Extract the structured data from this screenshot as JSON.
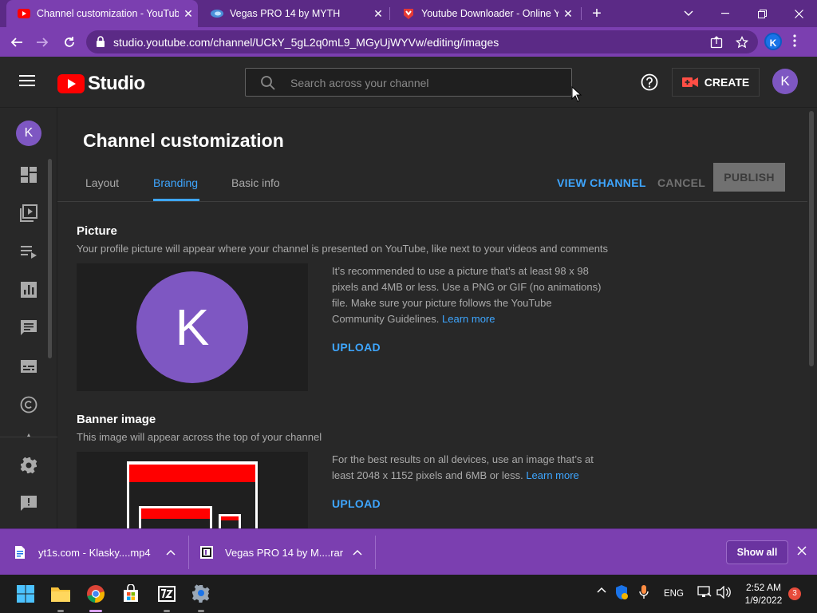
{
  "browser": {
    "tabs": [
      {
        "title": "Channel customization - YouTub",
        "active": true
      },
      {
        "title": "Vegas PRO 14 by MYTH",
        "active": false
      },
      {
        "title": "Youtube Downloader - Online Yo",
        "active": false
      }
    ],
    "url": "studio.youtube.com/channel/UCkY_5gL2q0mL9_MGyUjWYVw/editing/images",
    "profile_initial": "K"
  },
  "header": {
    "logo_text": "Studio",
    "search_placeholder": "Search across your channel",
    "create_label": "CREATE",
    "avatar_initial": "K"
  },
  "sidebar": {
    "avatar_initial": "K",
    "items": [
      "dashboard",
      "content",
      "playlists",
      "analytics",
      "comments",
      "subtitles",
      "copyright",
      "settings",
      "feedback"
    ]
  },
  "main": {
    "title": "Channel customization",
    "tabs": [
      "Layout",
      "Branding",
      "Basic info"
    ],
    "selected_tab": "Branding",
    "view_channel": "VIEW CHANNEL",
    "cancel": "CANCEL",
    "publish": "PUBLISH",
    "picture": {
      "title": "Picture",
      "description": "Your profile picture will appear where your channel is presented on YouTube, like next to your videos and comments",
      "avatar_letter": "K",
      "info": "It’s recommended to use a picture that’s at least 98 x 98 pixels and 4MB or less. Use a PNG or GIF (no animations) file. Make sure your picture follows the YouTube Community Guidelines.",
      "learn_more": "Learn more",
      "upload": "UPLOAD"
    },
    "banner": {
      "title": "Banner image",
      "description": "This image will appear across the top of your channel",
      "info": "For the best results on all devices, use an image that’s at least 2048 x 1152 pixels and 6MB or less.",
      "learn_more": "Learn more",
      "upload": "UPLOAD"
    }
  },
  "downloads": {
    "items": [
      {
        "name": "yt1s.com - Klasky....mp4"
      },
      {
        "name": "Vegas PRO 14 by M....rar"
      }
    ],
    "show_all": "Show all"
  },
  "taskbar": {
    "lang": "ENG",
    "time": "2:52 AM",
    "date": "1/9/2022",
    "notifications": "3"
  },
  "colors": {
    "browser_frame": "#5b2a86",
    "browser_toolbar": "#7b3fb0",
    "yt_background": "#282828",
    "accent_blue": "#3ea6ff",
    "avatar_purple": "#7e57c2",
    "yt_red": "#ff0000"
  }
}
